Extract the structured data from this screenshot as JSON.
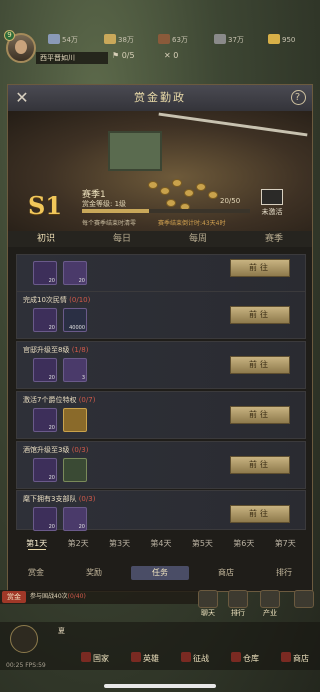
{
  "player": {
    "vip": "9",
    "name": "西平晋如川"
  },
  "resources": [
    {
      "icon": "silver-icon",
      "value": "54万",
      "color": "#8a9ab8"
    },
    {
      "icon": "wheat-icon",
      "value": "38万",
      "color": "#c9a85a"
    },
    {
      "icon": "wood-icon",
      "value": "63万",
      "color": "#8a5a3a"
    },
    {
      "icon": "stone-icon",
      "value": "37万",
      "color": "#8a8a8a"
    },
    {
      "icon": "gold-icon",
      "value": "950",
      "color": "#d8b048"
    }
  ],
  "sub_resources": [
    {
      "icon": "troops-icon",
      "value": "0/5"
    },
    {
      "icon": "swords-icon",
      "value": "0"
    }
  ],
  "panel": {
    "title": "赏金勤政",
    "season_badge": "S1",
    "season_title": "赛季1",
    "season_level": "赏金等级: 1级",
    "progress_text": "20/50",
    "progress_fraction": 0.4,
    "season_note": "每个赛季结束时清零",
    "season_end": "赛季结束倒计时:43天4时",
    "not_activated": "未激活",
    "tabs": [
      "初识",
      "每日",
      "每周",
      "赛季"
    ],
    "active_tab": 0
  },
  "tasks": [
    {
      "title": "",
      "count": "",
      "rewards": [
        {
          "kind": "scroll-icon",
          "qty": "20"
        },
        {
          "kind": "unit-icon",
          "qty": "20"
        }
      ],
      "button": "前往"
    },
    {
      "title": "完成10次民情",
      "count": "(0/10)",
      "rewards": [
        {
          "kind": "scroll-icon",
          "qty": "20"
        },
        {
          "kind": "ring-icon",
          "qty": "40000"
        }
      ],
      "button": "前往"
    },
    {
      "title": "官邸升级至8级",
      "count": "(1/8)",
      "rewards": [
        {
          "kind": "scroll-icon",
          "qty": "20"
        },
        {
          "kind": "potion-icon",
          "qty": "3"
        }
      ],
      "button": "前往"
    },
    {
      "title": "激活7个爵位特权",
      "count": "(0/7)",
      "rewards": [
        {
          "kind": "scroll-icon",
          "qty": "20"
        },
        {
          "kind": "mystery-icon",
          "qty": ""
        }
      ],
      "button": "前往"
    },
    {
      "title": "酒馆升级至3级",
      "count": "(0/3)",
      "rewards": [
        {
          "kind": "scroll-icon",
          "qty": "20"
        },
        {
          "kind": "jar-icon",
          "qty": ""
        }
      ],
      "button": "前往"
    },
    {
      "title": "麾下拥有3支部队",
      "count": "(0/3)",
      "rewards": [
        {
          "kind": "scroll-icon",
          "qty": "20"
        },
        {
          "kind": "unit-icon",
          "qty": "20"
        }
      ],
      "button": "前往"
    }
  ],
  "days": [
    "第1天",
    "第2天",
    "第3天",
    "第4天",
    "第5天",
    "第6天",
    "第7天"
  ],
  "active_day": 0,
  "bottom_tabs": [
    "赏金",
    "奖励",
    "任务",
    "商店",
    "排行"
  ],
  "active_bottom_tab": 2,
  "hud": {
    "quest_tag": "赏金",
    "quest_text": "参与国战40次",
    "quest_count": "(0/40)",
    "side_buttons": [
      "聊天",
      "排行",
      "产业",
      ""
    ],
    "chat_text": "夏",
    "fps": "00:25   FPS:59",
    "nav": [
      "国家",
      "英雄",
      "征战",
      "仓库",
      "商店"
    ]
  }
}
